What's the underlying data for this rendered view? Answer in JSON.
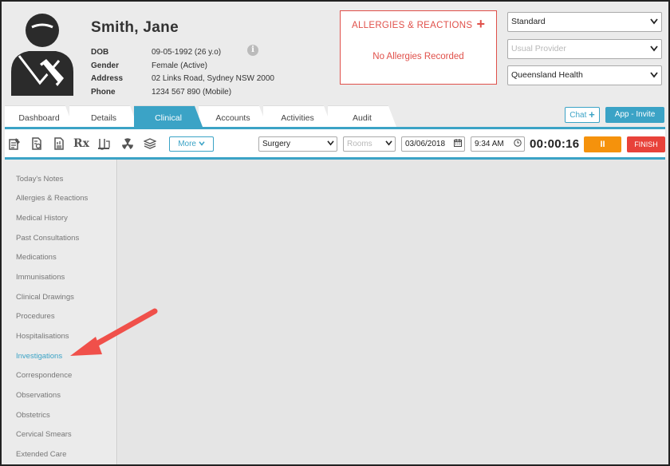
{
  "patient": {
    "name": "Smith, Jane",
    "fields": [
      {
        "label": "DOB",
        "value": "09-05-1992 (26 y.o)"
      },
      {
        "label": "Gender",
        "value": "Female (Active)"
      },
      {
        "label": "Address",
        "value": "02 Links Road, Sydney NSW 2000"
      },
      {
        "label": "Phone",
        "value": "1234 567 890 (Mobile)"
      }
    ]
  },
  "allergies": {
    "title": "ALLERGIES & REACTIONS",
    "add": "+",
    "empty_text": "No Allergies Recorded"
  },
  "header_selects": {
    "appointment_type": "Standard",
    "provider_placeholder": "Usual Provider",
    "health_fund": "Queensland Health"
  },
  "tabs": [
    {
      "label": "Dashboard",
      "active": false
    },
    {
      "label": "Details",
      "active": false
    },
    {
      "label": "Clinical",
      "active": true
    },
    {
      "label": "Accounts",
      "active": false
    },
    {
      "label": "Activities",
      "active": false
    },
    {
      "label": "Audit",
      "active": false
    }
  ],
  "header_buttons": {
    "chat": "Chat",
    "chat_plus": "+",
    "app_invite": "App - Invite"
  },
  "toolbar": {
    "icons": [
      "notes-icon",
      "document-icon",
      "report-icon",
      "prescription-icon",
      "lab-icon",
      "radiation-icon",
      "books-icon"
    ],
    "rx_symbol": "Rx",
    "more_label": "More",
    "location": "Surgery",
    "rooms_placeholder": "Rooms",
    "date": "03/06/2018",
    "time": "9:34 AM",
    "timer": "00:00:16",
    "finish_label": "FINISH",
    "pause_glyph": "II"
  },
  "sidebar": {
    "items": [
      {
        "label": "Today's Notes",
        "active": false
      },
      {
        "label": "Allergies & Reactions",
        "active": false
      },
      {
        "label": "Medical History",
        "active": false
      },
      {
        "label": "Past Consultations",
        "active": false
      },
      {
        "label": "Medications",
        "active": false
      },
      {
        "label": "Immunisations",
        "active": false
      },
      {
        "label": "Clinical Drawings",
        "active": false
      },
      {
        "label": "Procedures",
        "active": false
      },
      {
        "label": "Hospitalisations",
        "active": false
      },
      {
        "label": "Investigations",
        "active": true
      },
      {
        "label": "Correspondence",
        "active": false
      },
      {
        "label": "Observations",
        "active": false
      },
      {
        "label": "Obstetrics",
        "active": false
      },
      {
        "label": "Cervical Smears",
        "active": false
      },
      {
        "label": "Extended Care",
        "active": false
      }
    ]
  },
  "colors": {
    "accent": "#3ba3c6",
    "alert": "#e0504a",
    "pause": "#f5920c",
    "finish": "#e8423a",
    "annotation_arrow": "#f0504a"
  }
}
